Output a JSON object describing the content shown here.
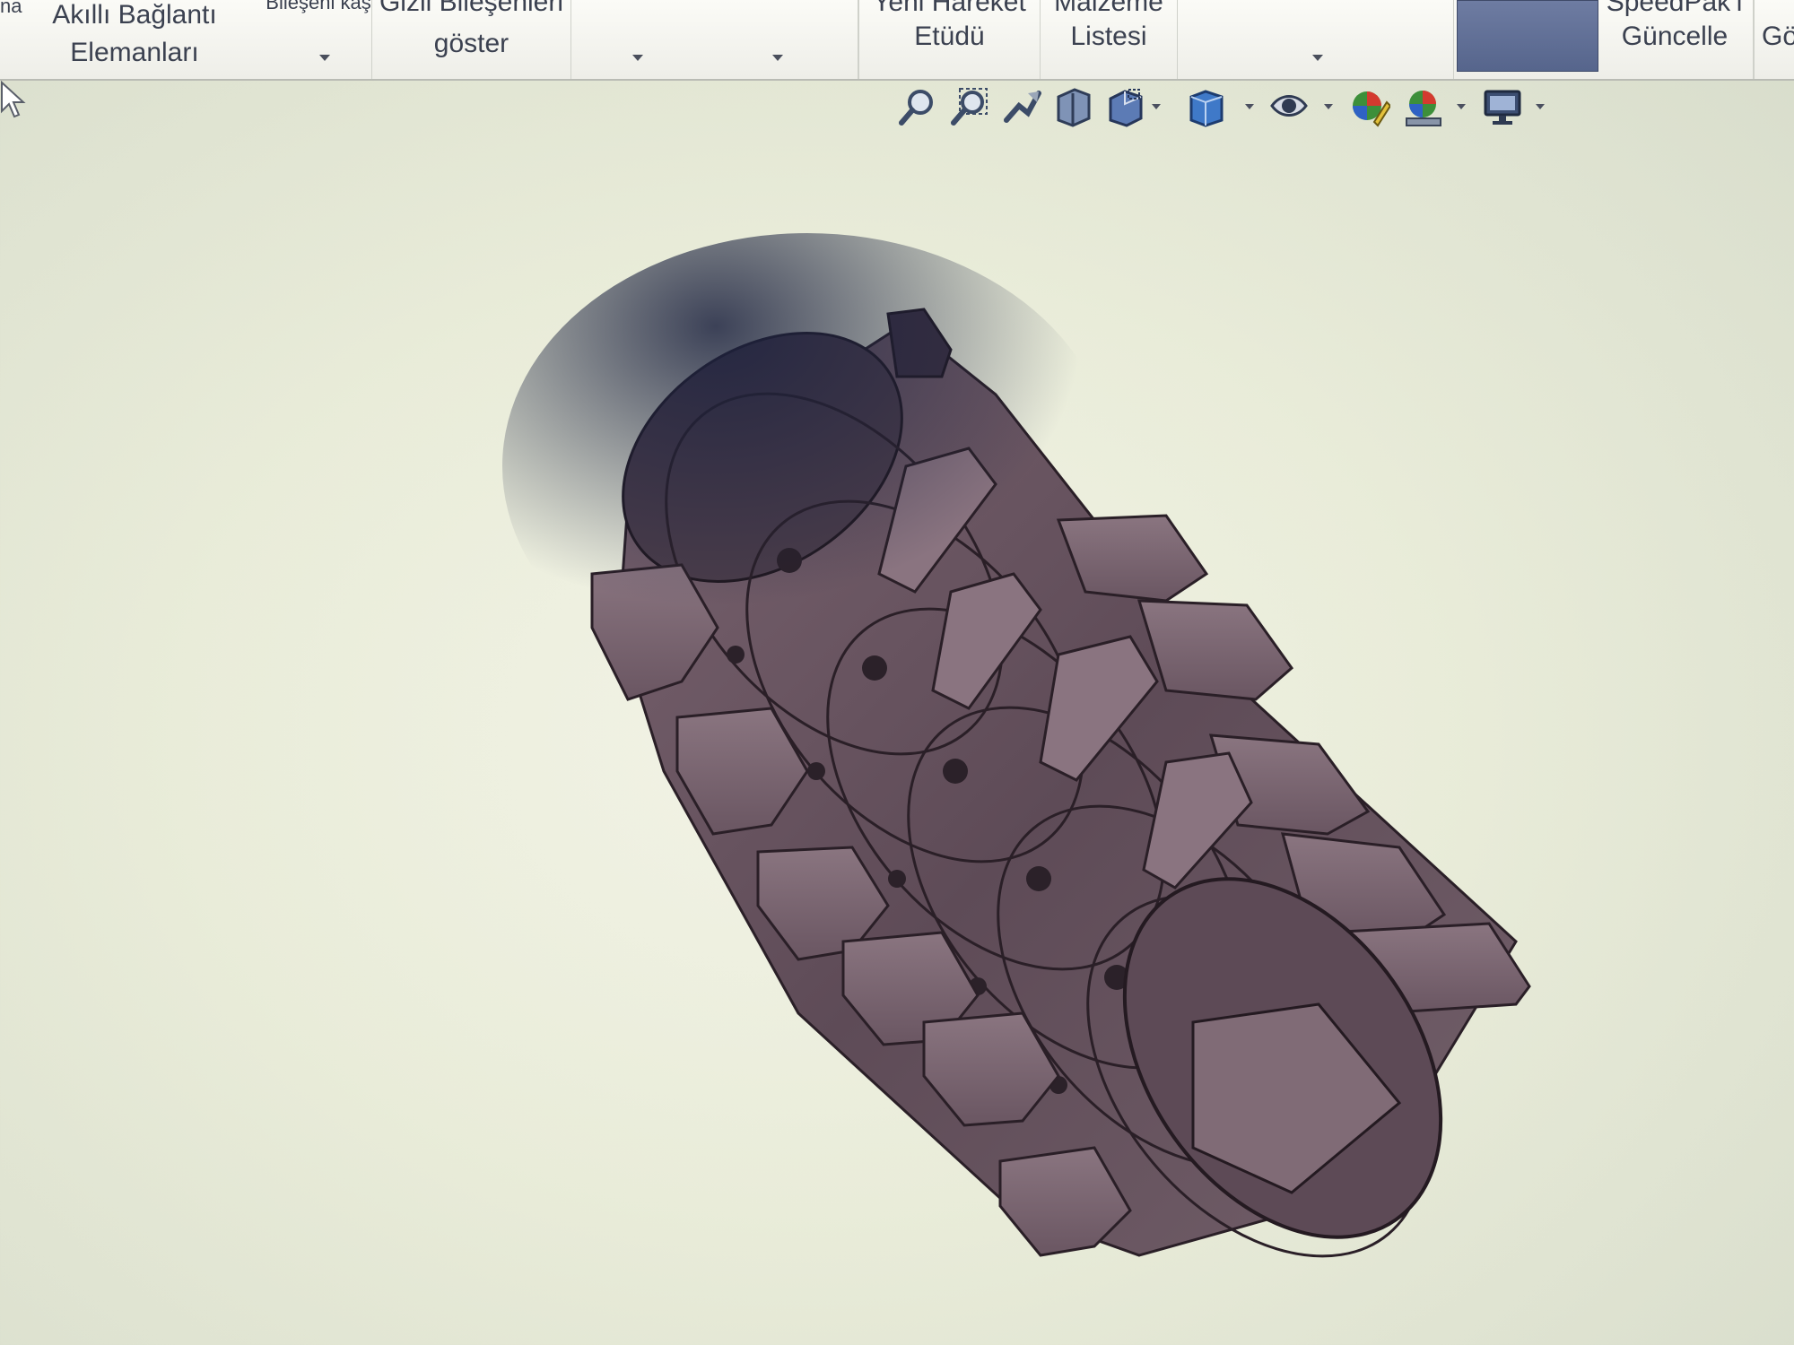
{
  "ribbon": {
    "partial_left": "na",
    "smart_fasteners": {
      "line1": "Akıllı Bağlantı",
      "line2": "Elemanları"
    },
    "component_cut": "Bileşeni kaş",
    "hidden_components": {
      "line1": "Gizli Bileşenleri",
      "line2": "göster"
    },
    "motion_study": {
      "line1": "Yeni Hareket",
      "line2": "Etüdü"
    },
    "bom": {
      "line1": "Malzeme",
      "line2": "Listesi"
    },
    "speedpak": {
      "line1": "SpeedPak'ı",
      "line2": "Güncelle"
    },
    "partial_right": "Gö",
    "accent_color": "#5d6b93"
  },
  "heads_up_toolbar": {
    "tools": [
      "zoom-to-fit-icon",
      "zoom-to-area-icon",
      "previous-view-icon",
      "section-view-icon",
      "view-orientation-icon",
      "display-style-icon",
      "hide-show-items-icon",
      "edit-appearance-icon",
      "apply-scene-icon",
      "view-settings-icon"
    ]
  },
  "model": {
    "body_color": "#6b5660",
    "shadow_color": "#2a2f4a"
  }
}
